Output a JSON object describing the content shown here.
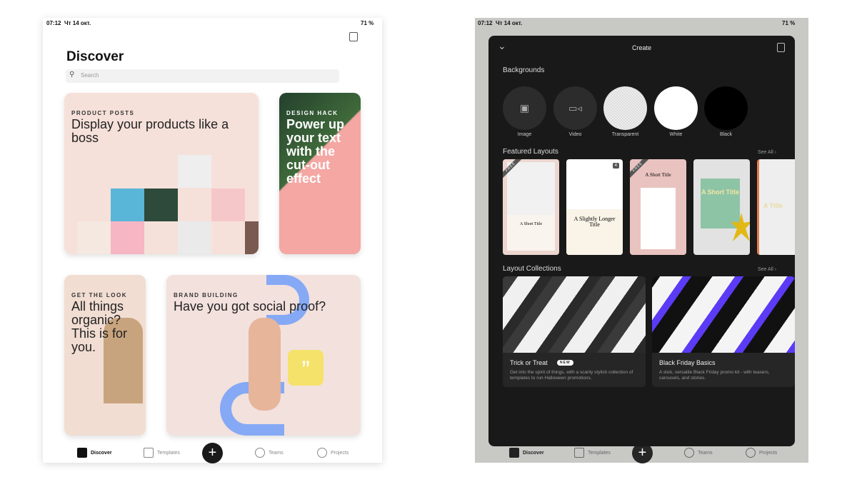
{
  "status": {
    "time": "07:12",
    "date": "Чт 14 окт.",
    "battery": "71 %"
  },
  "discover": {
    "title": "Discover",
    "search_placeholder": "Search",
    "cards": [
      {
        "kicker": "PRODUCT POSTS",
        "title": "Display your products like a boss",
        "color": "#f6e1da"
      },
      {
        "kicker": "DESIGN HACK",
        "title": "Power up your text with the cut-out effect",
        "color": "#f4a7a3"
      },
      {
        "kicker": "GET THE LOOK",
        "title": "All things organic? This is for you.",
        "color": "#f1ddd2"
      },
      {
        "kicker": "BRAND BUILDING",
        "title": "Have you got social proof?",
        "color": "#f3e1de"
      }
    ]
  },
  "nav": {
    "items": [
      {
        "label": "Discover"
      },
      {
        "label": "Templates"
      },
      {
        "label": "Teams"
      },
      {
        "label": "Projects"
      }
    ],
    "create": "+"
  },
  "create": {
    "title": "Create",
    "backgrounds_heading": "Backgrounds",
    "backgrounds": [
      {
        "label": "Image"
      },
      {
        "label": "Video"
      },
      {
        "label": "Transparent"
      },
      {
        "label": "White"
      },
      {
        "label": "Black"
      }
    ],
    "featured_heading": "Featured Layouts",
    "see_all": "See All",
    "featured": [
      {
        "badge": "FREE",
        "title": "A Short Title"
      },
      {
        "count": "4",
        "title": "A Slightly Longer Title"
      },
      {
        "badge": "FREE",
        "title": "A Short Title"
      },
      {
        "title": "A Short Title"
      },
      {
        "title": "A Title"
      }
    ],
    "collections_heading": "Layout Collections",
    "collections": [
      {
        "title": "Trick or Treat",
        "badge": "NEW",
        "desc": "Get into the spirit of things, with a scarily stylish collection of templates to run Halloween promotions."
      },
      {
        "title": "Black Friday Basics",
        "desc": "A slick, versatile Black Friday promo kit - with teasers, carousels, and stories."
      }
    ]
  },
  "colors": {
    "accent": "#1a1a1a",
    "sheet": "#191919",
    "violet": "#5b3bf5"
  }
}
